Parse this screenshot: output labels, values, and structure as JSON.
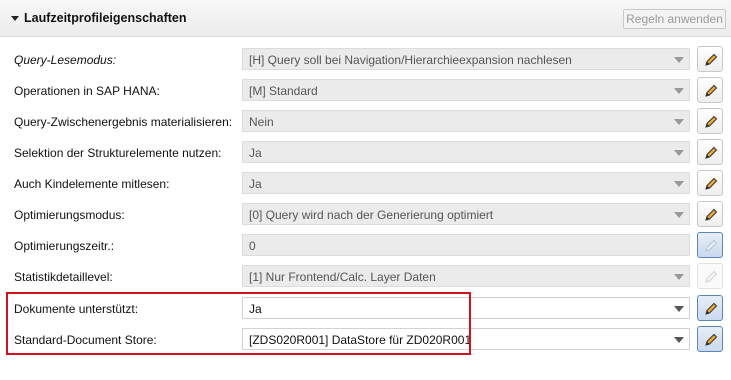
{
  "header": {
    "title": "Laufzeitprofileigenschaften",
    "expand_icon": "triangle-down-icon",
    "apply_rules_label": "Regeln anwenden"
  },
  "rows": [
    {
      "label": "Query-Lesemodus:",
      "value": "[H] Query soll bei Navigation/Hierarchieexpansion nachlesen"
    },
    {
      "label": "Operationen in SAP HANA:",
      "value": "[M] Standard"
    },
    {
      "label": "Query-Zwischenergebnis materialisieren:",
      "value": "Nein"
    },
    {
      "label": "Selektion der Strukturelemente nutzen:",
      "value": "Ja"
    },
    {
      "label": "Auch Kindelemente mitlesen:",
      "value": "Ja"
    },
    {
      "label": "Optimierungsmodus:",
      "value": "[0] Query wird nach der Generierung optimiert"
    },
    {
      "label": "Optimierungszeitr.:",
      "value": "0"
    },
    {
      "label": "Statistikdetaillevel:",
      "value": "[1] Nur Frontend/Calc. Layer Daten"
    },
    {
      "label": "Dokumente unterstützt:",
      "value": "Ja"
    },
    {
      "label": "Standard-Document Store:",
      "value": "[ZDS020R001] DataStore für ZD020R001"
    }
  ],
  "icons": {
    "edit": "pencil-icon",
    "dropdown": "chevron-down-icon"
  },
  "colors": {
    "highlight_border": "#d1121d",
    "pencil_fill": "#f0a830",
    "selected_button": "#5b87b8"
  }
}
